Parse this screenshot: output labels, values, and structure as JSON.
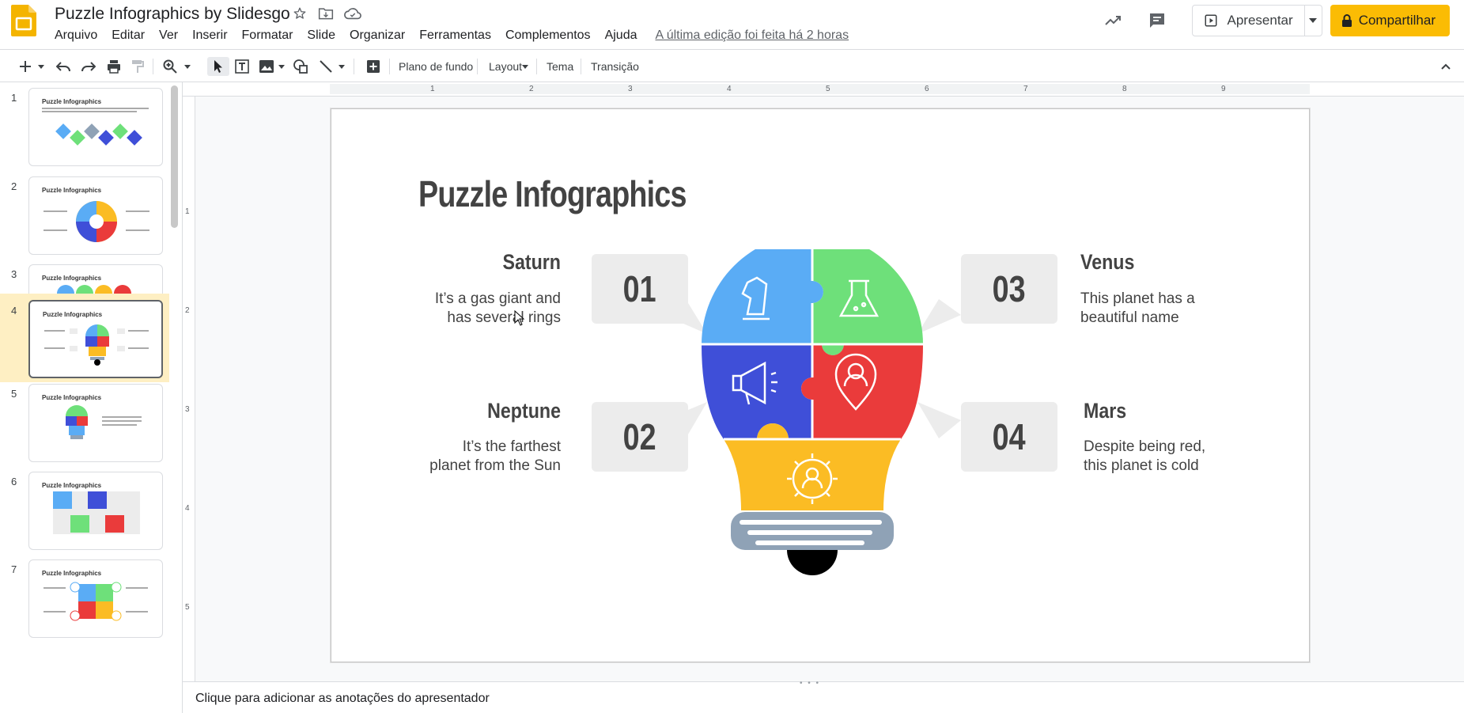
{
  "header": {
    "title": "Puzzle Infographics by Slidesgo",
    "menu": [
      "Arquivo",
      "Editar",
      "Ver",
      "Inserir",
      "Formatar",
      "Slide",
      "Organizar",
      "Ferramentas",
      "Complementos",
      "Ajuda"
    ],
    "last_edit": "A última edição foi feita há 2 horas",
    "present_label": "Apresentar",
    "share_label": "Compartilhar"
  },
  "toolbar": {
    "background_label": "Plano de fundo",
    "layout_label": "Layout",
    "theme_label": "Tema",
    "transition_label": "Transição"
  },
  "filmstrip": {
    "selected_index": 4,
    "slides": [
      {
        "number": "1",
        "title": "Puzzle Infographics"
      },
      {
        "number": "2",
        "title": "Puzzle Infographics"
      },
      {
        "number": "3",
        "title": "Puzzle Infographics"
      },
      {
        "number": "4",
        "title": "Puzzle Infographics"
      },
      {
        "number": "5",
        "title": "Puzzle Infographics"
      },
      {
        "number": "6",
        "title": "Puzzle Infographics"
      },
      {
        "number": "7",
        "title": "Puzzle Infographics"
      }
    ]
  },
  "ruler": {
    "top_numbers": [
      "1",
      "2",
      "3",
      "4",
      "5",
      "6",
      "7",
      "8",
      "9"
    ],
    "left_numbers": [
      "1",
      "2",
      "3",
      "4",
      "5"
    ]
  },
  "slide": {
    "title": "Puzzle Infographics",
    "items": [
      {
        "number": "01",
        "heading": "Saturn",
        "body_line1": "It’s a gas giant and",
        "body_line2": "has several rings"
      },
      {
        "number": "02",
        "heading": "Neptune",
        "body_line1": "It’s the farthest",
        "body_line2": "planet from the Sun"
      },
      {
        "number": "03",
        "heading": "Venus",
        "body_line1": "This planet has a",
        "body_line2": "beautiful name"
      },
      {
        "number": "04",
        "heading": "Mars",
        "body_line1": "Despite being red,",
        "body_line2": "this planet is cold"
      }
    ],
    "colors": {
      "blue": "#5aacf5",
      "green": "#6ee07a",
      "indigo": "#3f4fd8",
      "red": "#ea3b3b",
      "yellow": "#fbbc24",
      "gray": "#8fa2b6"
    }
  },
  "notes": {
    "placeholder": "Clique para adicionar as anotações do apresentador"
  },
  "colors": {
    "accent": "#fbbc04",
    "selected_slide_bg": "#feefc3"
  }
}
